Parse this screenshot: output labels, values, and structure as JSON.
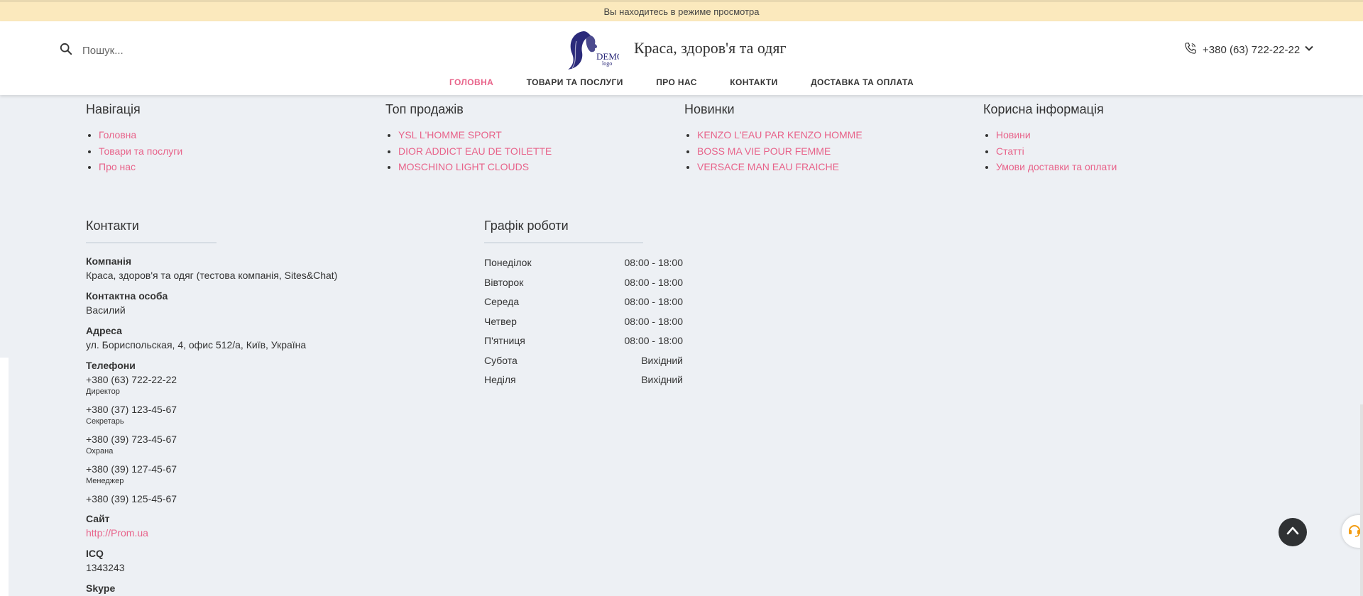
{
  "preview_bar": {
    "text": "Вы находитесь в режиме просмотра"
  },
  "header": {
    "search_placeholder": "Пошук...",
    "site_title": "Краса, здоров'я та одяг",
    "phone": "+380 (63) 722-22-22",
    "logo_text": "DEMO logo"
  },
  "nav": [
    {
      "label": "Головна",
      "active": true
    },
    {
      "label": "Товари та послуги"
    },
    {
      "label": "Про нас"
    },
    {
      "label": "Контакти"
    },
    {
      "label": "Доставка та оплата"
    }
  ],
  "footer_columns": [
    {
      "title": "Навігація",
      "items": [
        "Головна",
        "Товари та послуги",
        "Про нас"
      ]
    },
    {
      "title": "Топ продажів",
      "items": [
        "YSL L'HOMME SPORT",
        "DIOR ADDICT EAU DE TOILETTE",
        "MOSCHINO LIGHT CLOUDS"
      ]
    },
    {
      "title": "Новинки",
      "items": [
        "KENZO L'EAU PAR KENZO HOMME",
        "BOSS MA VIE POUR FEMME",
        "VERSACE MAN EAU FRAICHE"
      ]
    },
    {
      "title": "Корисна інформація",
      "items": [
        "Новини",
        "Статті",
        "Умови доставки та оплати"
      ]
    }
  ],
  "contacts": {
    "title": "Контакти",
    "company_label": "Компанія",
    "company": "Краса, здоров'я та одяг (тестова компанія, Sites&Chat)",
    "person_label": "Контактна особа",
    "person": "Василий",
    "address_label": "Адреса",
    "address": "ул. Бориспольская, 4, офис 512/а, Київ, Україна",
    "phones_label": "Телефони",
    "phones": [
      {
        "number": "+380 (63) 722-22-22",
        "note": "Директор"
      },
      {
        "number": "+380 (37) 123-45-67",
        "note": "Секретарь"
      },
      {
        "number": "+380 (39) 723-45-67",
        "note": "Охрана"
      },
      {
        "number": "+380 (39) 127-45-67",
        "note": "Менеджер"
      },
      {
        "number": "+380 (39) 125-45-67",
        "note": ""
      }
    ],
    "site_label": "Сайт",
    "site": "http://Prom.ua",
    "icq_label": "ICQ",
    "icq": "1343243",
    "skype_label": "Skype"
  },
  "schedule": {
    "title": "Графік роботи",
    "rows": [
      {
        "day": "Понеділок",
        "hours": "08:00 - 18:00"
      },
      {
        "day": "Вівторок",
        "hours": "08:00 - 18:00"
      },
      {
        "day": "Середа",
        "hours": "08:00 - 18:00"
      },
      {
        "day": "Четвер",
        "hours": "08:00 - 18:00"
      },
      {
        "day": "П'ятниця",
        "hours": "08:00 - 18:00"
      },
      {
        "day": "Субота",
        "hours": "Вихідний"
      },
      {
        "day": "Неділя",
        "hours": "Вихідний"
      }
    ]
  },
  "colors": {
    "accent": "#e8638a",
    "preview_bg": "#fbe9bd",
    "footer_bg": "#edf0f4",
    "logo": "#2b2a7a"
  },
  "icons": [
    "search-icon",
    "phone-icon",
    "chevron-down-icon",
    "arrow-up-icon",
    "headset-icon"
  ]
}
